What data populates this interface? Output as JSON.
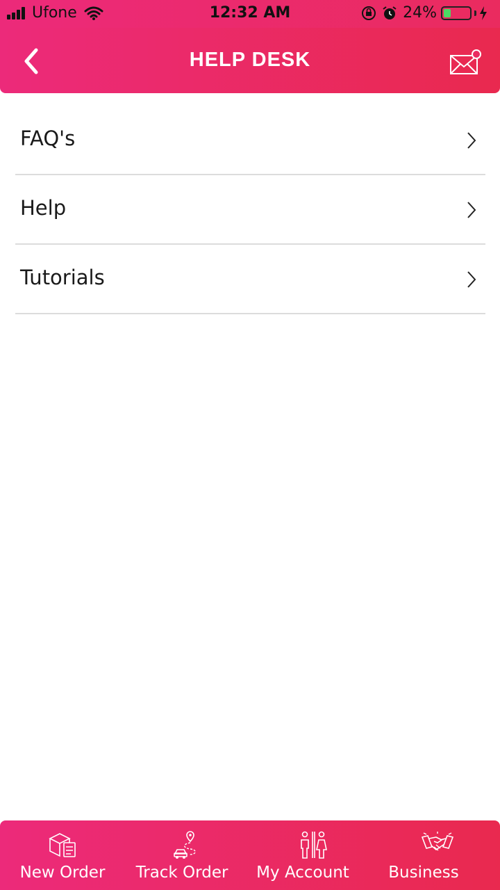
{
  "status_bar": {
    "carrier": "Ufone",
    "time": "12:32 AM",
    "battery": "24%",
    "battery_level": 0.24
  },
  "header": {
    "title": "HELP DESK"
  },
  "menu": {
    "items": [
      {
        "label": "FAQ's"
      },
      {
        "label": "Help"
      },
      {
        "label": "Tutorials"
      }
    ]
  },
  "bottom_nav": {
    "items": [
      {
        "label": "New Order",
        "icon": "box-clipboard-icon"
      },
      {
        "label": "Track Order",
        "icon": "route-pin-icon"
      },
      {
        "label": "My Account",
        "icon": "people-icon"
      },
      {
        "label": "Business",
        "icon": "handshake-icon"
      }
    ]
  },
  "colors": {
    "accent_start": "#ec2a7a",
    "accent_end": "#e9294f",
    "divider": "#dcdcdc"
  }
}
